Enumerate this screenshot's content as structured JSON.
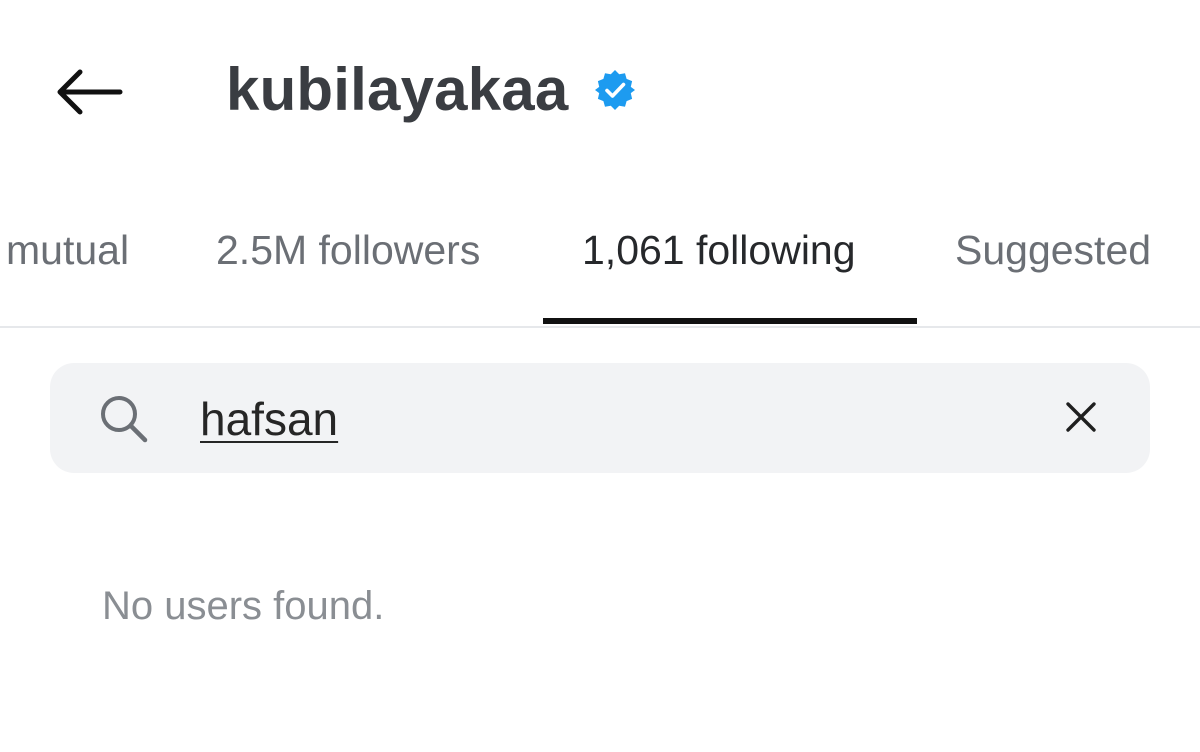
{
  "header": {
    "back_icon": "arrow-left-icon",
    "username": "kubilayakaa",
    "verified_icon": "verified-badge-icon",
    "verified_color": "#1d9bf0"
  },
  "tabs": [
    {
      "label": "mutual",
      "active": false
    },
    {
      "label": "2.5M followers",
      "active": false
    },
    {
      "label": "1,061 following",
      "active": true
    },
    {
      "label": "Suggested",
      "active": false
    }
  ],
  "search": {
    "icon": "search-icon",
    "value": "hafsan",
    "clear_icon": "close-icon"
  },
  "results": {
    "empty_message": "No users found."
  }
}
